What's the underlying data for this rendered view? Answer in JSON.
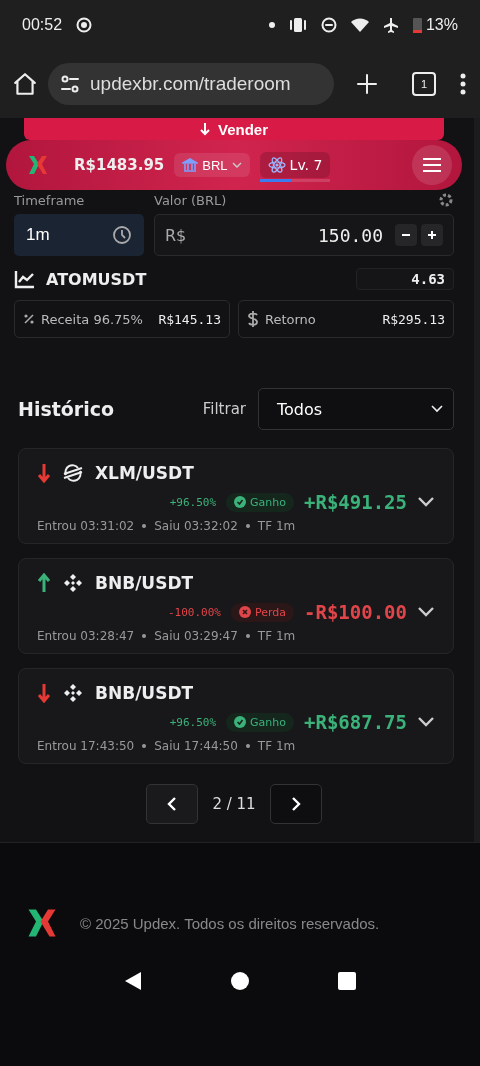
{
  "status_bar": {
    "time": "00:52",
    "battery": "13%"
  },
  "browser": {
    "url": "updexbr.com/traderoom",
    "tab_count": "1"
  },
  "sell_button": {
    "label": "Vender"
  },
  "header": {
    "balance": "R$1483.95",
    "currency": "BRL",
    "level_label": "Lv. 7",
    "level": 0.45
  },
  "trade_form": {
    "timeframe_label": "Timeframe",
    "timeframe_value": "1m",
    "amount_label": "Valor (BRL)",
    "currency_prefix": "R$",
    "amount_value": "150.00",
    "asset": "ATOMUSDT",
    "price": "4.63",
    "revenue_label": "Receita 96.75%",
    "revenue_value": "R$145.13",
    "return_label": "Retorno",
    "return_value": "R$295.13"
  },
  "history": {
    "title": "Histórico",
    "filter_label": "Filtrar",
    "filter_value": "Todos",
    "trades": [
      {
        "up": false,
        "kind": "stellar",
        "pair": "XLM/USDT",
        "percent": "+96.50%",
        "won": true,
        "result_label": "Ganho",
        "amount": "+R$491.25",
        "entered": "Entrou 03:31:02",
        "exited": "Saiu 03:32:02",
        "timeframe": "TF 1m"
      },
      {
        "up": true,
        "kind": "binance",
        "pair": "BNB/USDT",
        "percent": "-100.00%",
        "won": false,
        "result_label": "Perda",
        "amount": "-R$100.00",
        "entered": "Entrou 03:28:47",
        "exited": "Saiu 03:29:47",
        "timeframe": "TF 1m"
      },
      {
        "up": false,
        "kind": "binance",
        "pair": "BNB/USDT",
        "percent": "+96.50%",
        "won": true,
        "result_label": "Ganho",
        "amount": "+R$687.75",
        "entered": "Entrou 17:43:50",
        "exited": "Saiu 17:44:50",
        "timeframe": "TF 1m"
      }
    ],
    "page": "2 / 11"
  },
  "footer": {
    "text": "© 2025 Updex. Todos os direitos reservados."
  }
}
